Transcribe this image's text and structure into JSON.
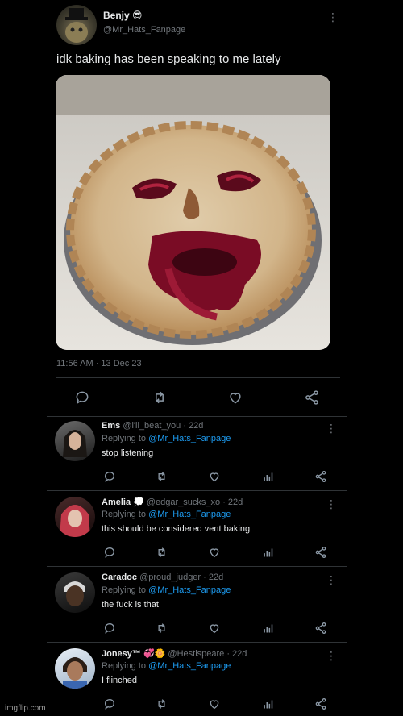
{
  "main_tweet": {
    "display_name": "Benjy 😎",
    "handle": "@Mr_Hats_Fanpage",
    "text": "idk baking has been speaking to me lately",
    "timestamp": "11:56 AM · 13 Dec 23",
    "image_alt": "pie with a face"
  },
  "actions": {
    "reply_icon": "reply-icon",
    "retweet_icon": "retweet-icon",
    "like_icon": "heart-icon",
    "share_icon": "share-icon",
    "views_icon": "views-icon"
  },
  "replies": [
    {
      "name": "Ems",
      "handle": "@i'll_beat_you · 22d",
      "replying_prefix": "Replying to",
      "replying_to": "@Mr_Hats_Fanpage",
      "text": "stop listening"
    },
    {
      "name": "Amelia 💭",
      "handle": "@edgar_sucks_xo · 22d",
      "replying_prefix": "Replying to",
      "replying_to": "@Mr_Hats_Fanpage",
      "text": "this should be considered vent baking"
    },
    {
      "name": "Caradoc",
      "handle": "@proud_judger · 22d",
      "replying_prefix": "Replying to",
      "replying_to": "@Mr_Hats_Fanpage",
      "text": "the fuck is that"
    },
    {
      "name": "Jonesy™ 💞🌼",
      "handle": "@Hestispeare · 22d",
      "replying_prefix": "Replying to",
      "replying_to": "@Mr_Hats_Fanpage",
      "text": "I flinched"
    }
  ],
  "watermark": "imgflip.com",
  "colors": {
    "background": "#000000",
    "text": "#e7e9ea",
    "muted": "#71767b",
    "link": "#1d9bf0",
    "divider": "#2f3336"
  }
}
